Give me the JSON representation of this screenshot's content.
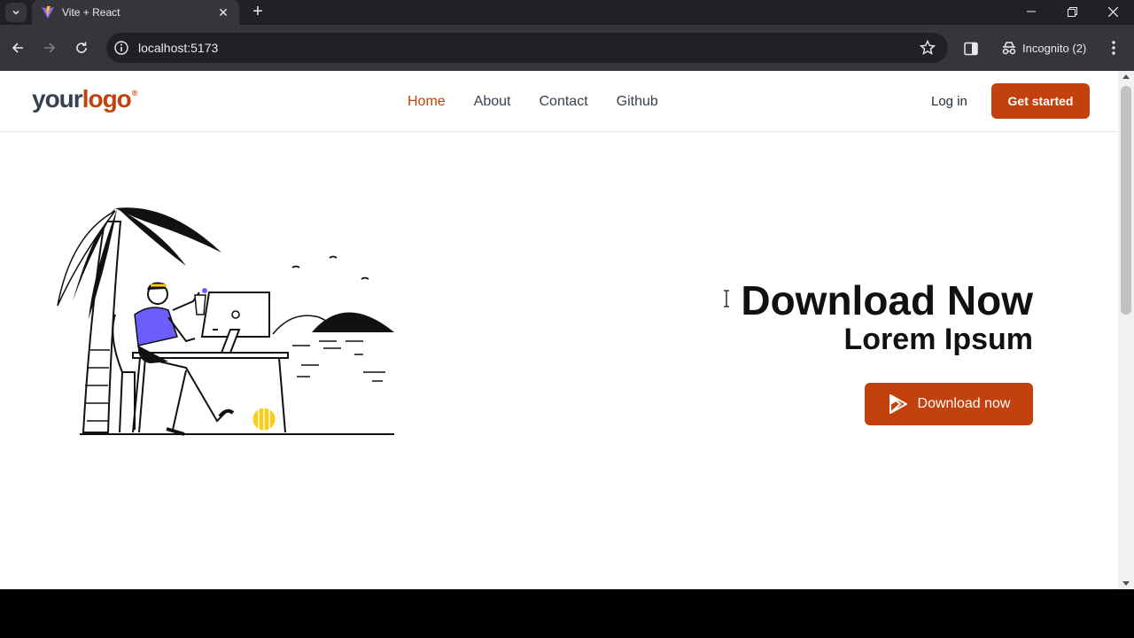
{
  "browser": {
    "tab_title": "Vite + React",
    "url": "localhost:5173",
    "incognito_label": "Incognito (2)"
  },
  "header": {
    "logo_your": "your",
    "logo_logo": "logo",
    "logo_mark": "®",
    "nav": [
      {
        "label": "Home",
        "active": true
      },
      {
        "label": "About",
        "active": false
      },
      {
        "label": "Contact",
        "active": false
      },
      {
        "label": "Github",
        "active": false
      }
    ],
    "login_label": "Log in",
    "cta_label": "Get started"
  },
  "hero": {
    "title": "Download Now",
    "subtitle": "Lorem Ipsum",
    "button_label": "Download now",
    "button_icon": "play-store-icon"
  },
  "colors": {
    "accent": "#c2410c",
    "illustration_shirt": "#6d5dfc",
    "illustration_ball": "#facc15"
  }
}
